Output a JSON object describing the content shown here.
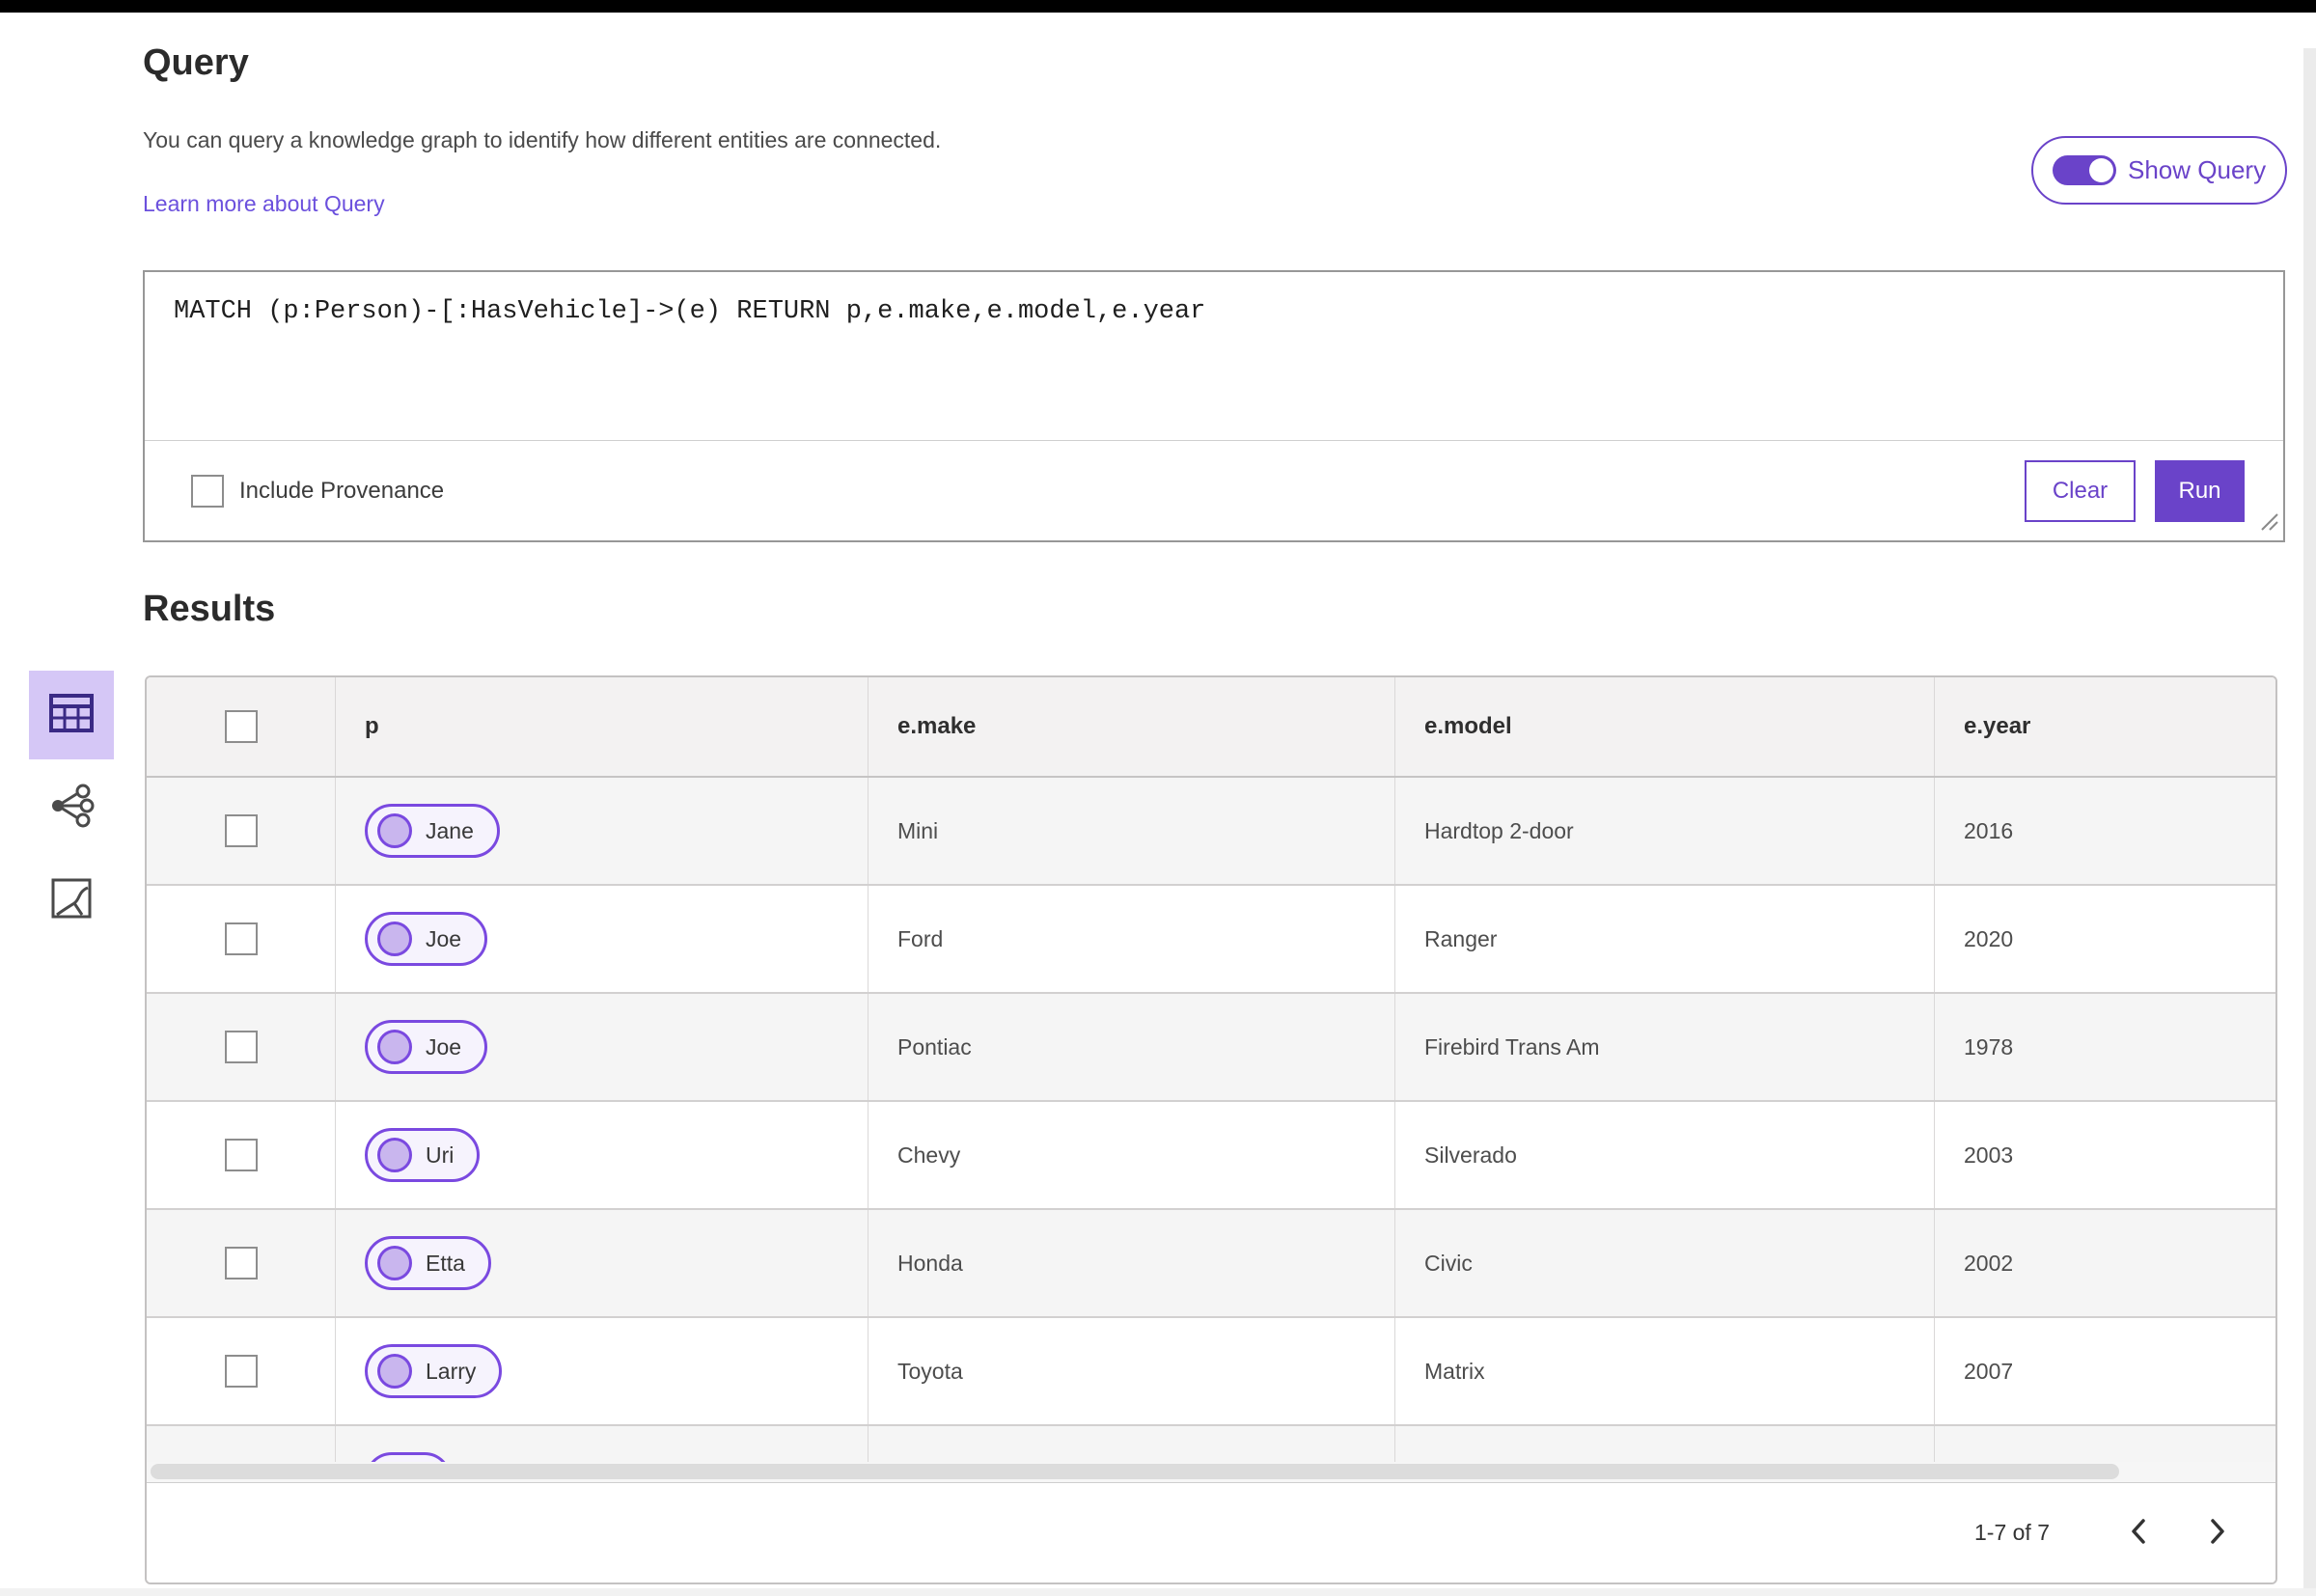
{
  "page": {
    "title": "Query",
    "description": "You can query a knowledge graph to identify how different entities are connected.",
    "learn_more_link": "Learn more about Query",
    "show_query_label": "Show Query",
    "show_query_on": true
  },
  "query_editor": {
    "text": "MATCH (p:Person)-[:HasVehicle]->(e) RETURN p,e.make,e.model,e.year",
    "include_provenance_label": "Include Provenance",
    "include_provenance_checked": false,
    "clear_label": "Clear",
    "run_label": "Run"
  },
  "results": {
    "title": "Results",
    "view_tabs": [
      {
        "name": "table-view",
        "icon": "table-icon",
        "selected": true
      },
      {
        "name": "link-chart-view",
        "icon": "link-chart-icon",
        "selected": false
      },
      {
        "name": "map-view",
        "icon": "map-icon",
        "selected": false
      }
    ],
    "table": {
      "columns": {
        "p": "p",
        "make": "e.make",
        "model": "e.model",
        "year": "e.year"
      },
      "rows": [
        {
          "p": "Jane",
          "make": "Mini",
          "model": "Hardtop 2-door",
          "year": "2016"
        },
        {
          "p": "Joe",
          "make": "Ford",
          "model": "Ranger",
          "year": "2020"
        },
        {
          "p": "Joe",
          "make": "Pontiac",
          "model": "Firebird Trans Am",
          "year": "1978"
        },
        {
          "p": "Uri",
          "make": "Chevy",
          "model": "Silverado",
          "year": "2003"
        },
        {
          "p": "Etta",
          "make": "Honda",
          "model": "Civic",
          "year": "2002"
        },
        {
          "p": "Larry",
          "make": "Toyota",
          "model": "Matrix",
          "year": "2007"
        },
        {
          "p": "",
          "make": "",
          "model": "",
          "year": "",
          "partially_visible": true
        }
      ],
      "pagination": {
        "range_label": "1-7 of 7",
        "prev_icon": "chevron-left-icon",
        "next_icon": "chevron-right-icon"
      }
    }
  },
  "colors": {
    "accent_purple": "#6a43c9",
    "chip_border_purple": "#7a49e0",
    "chip_fill_lavender": "#c9b6ee",
    "selected_tab_background": "#d5c7f6",
    "link_purple": "#6b50dd",
    "header_row_gray": "#f3f2f2",
    "alt_row_gray": "#f5f5f5"
  }
}
